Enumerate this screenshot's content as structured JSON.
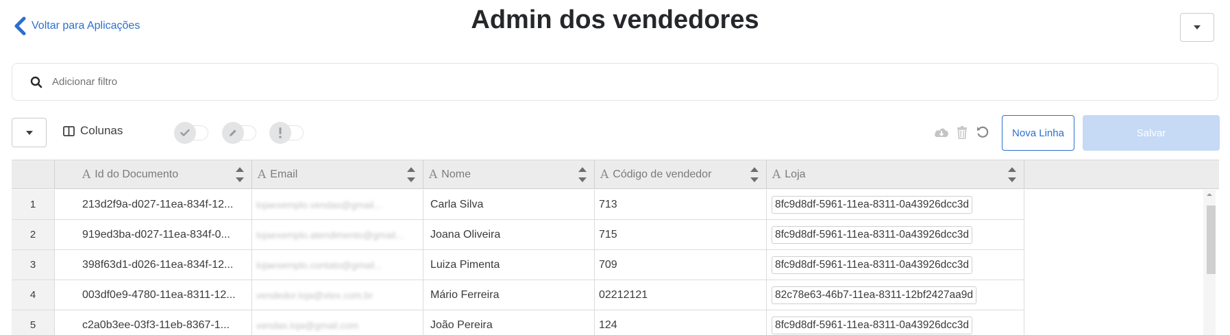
{
  "header": {
    "back_label": "Voltar para Aplicações",
    "title": "Admin dos vendedores"
  },
  "filter": {
    "placeholder": "Adicionar filtro"
  },
  "toolbar": {
    "columns_label": "Colunas",
    "new_row_label": "Nova Linha",
    "save_label": "Salvar"
  },
  "colors": {
    "accent": "#2b6fce",
    "save_disabled": "#c6d9f5"
  },
  "table": {
    "columns": [
      "Id do Documento",
      "Email",
      "Nome",
      "Código de vendedor",
      "Loja"
    ],
    "rows": [
      {
        "n": "1",
        "id": "213d2f9a-d027-11ea-834f-12...",
        "email": "lojaexemplo.vendas@gmail...",
        "nome": "Carla Silva",
        "codigo": "713",
        "loja": "8fc9d8df-5961-11ea-8311-0a43926dcc3d"
      },
      {
        "n": "2",
        "id": "919ed3ba-d027-11ea-834f-0...",
        "email": "lojaexemplo.atendimento@gmail...",
        "nome": "Joana Oliveira",
        "codigo": "715",
        "loja": "8fc9d8df-5961-11ea-8311-0a43926dcc3d"
      },
      {
        "n": "3",
        "id": "398f63d1-d026-11ea-834f-12...",
        "email": "lojaexemplo.contato@gmail...",
        "nome": "Luiza Pimenta",
        "codigo": "709",
        "loja": "8fc9d8df-5961-11ea-8311-0a43926dcc3d"
      },
      {
        "n": "4",
        "id": "003df0e9-4780-11ea-8311-12...",
        "email": "vendedor.loja@vtex.com.br",
        "nome": "Mário Ferreira",
        "codigo": "02212121",
        "loja": "82c78e63-46b7-11ea-8311-12bf2427aa9d"
      },
      {
        "n": "5",
        "id": "c2a0b3ee-03f3-11eb-8367-1...",
        "email": "vendas.loja@gmail.com",
        "nome": "João Pereira",
        "codigo": "124",
        "loja": "8fc9d8df-5961-11ea-8311-0a43926dcc3d"
      }
    ]
  }
}
